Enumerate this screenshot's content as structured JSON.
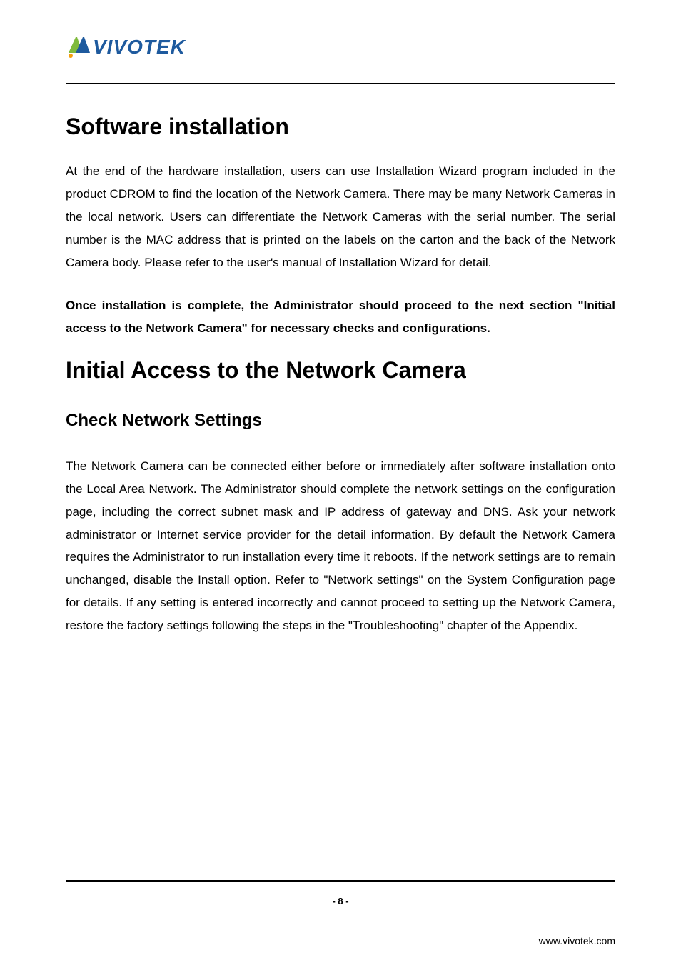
{
  "logo": {
    "brand_text": "VIVOTEK"
  },
  "sections": {
    "software_installation": {
      "title": "Software installation",
      "paragraph": "At the end of the hardware installation, users can use Installation Wizard program included in the product CDROM to find the location of the Network Camera. There may be many Network Cameras in the local network. Users can differentiate the Network Cameras with the serial number. The serial number is the MAC address that is printed on the labels on the carton and the back of the Network Camera body. Please refer to the user's manual of Installation Wizard for detail.",
      "bold_paragraph": "Once installation is complete, the Administrator should proceed to the next section \"Initial access to the Network Camera\" for necessary checks and configurations."
    },
    "initial_access": {
      "title": "Initial Access to the Network Camera",
      "subsection": {
        "title": "Check Network Settings",
        "paragraph": "The Network Camera can be connected either before or immediately after software installation onto the Local Area Network. The Administrator should complete the network settings on the configuration page, including the correct subnet mask and IP address of gateway and DNS. Ask your network administrator or Internet service provider for the detail information. By default the Network Camera requires the Administrator to run installation every time it reboots. If the network settings are to remain unchanged, disable the Install option. Refer to \"Network settings\" on the System Configuration page for details. If any setting is entered incorrectly and cannot proceed to setting up the Network Camera, restore the factory settings following the steps in the \"Troubleshooting\" chapter of the Appendix."
      }
    }
  },
  "footer": {
    "page_number": "- 8 -",
    "url": "www.vivotek.com"
  }
}
